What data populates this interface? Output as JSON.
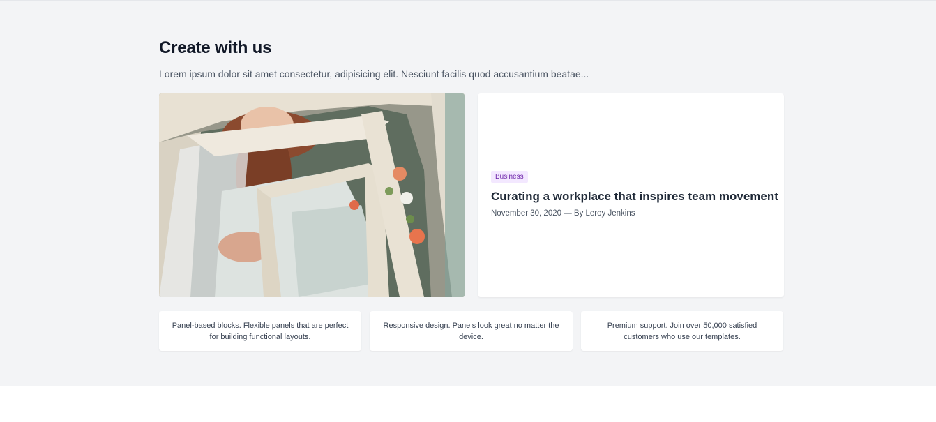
{
  "section": {
    "title": "Create with us",
    "subtitle": "Lorem ipsum dolor sit amet consectetur, adipisicing elit. Nesciunt facilis quod accusantium beatae..."
  },
  "post": {
    "badge": "Business",
    "badge_color": "#6b21a8",
    "title": "Curating a workplace that inspires team movement",
    "meta": "November 30, 2020 — By Leroy Jenkins"
  },
  "features": [
    {
      "text": "Panel-based blocks. Flexible panels that are perfect for building functional layouts."
    },
    {
      "text": "Responsive design. Panels look great no matter the device."
    },
    {
      "text": "Premium support. Join over 50,000 satisfied customers who use our templates."
    }
  ]
}
